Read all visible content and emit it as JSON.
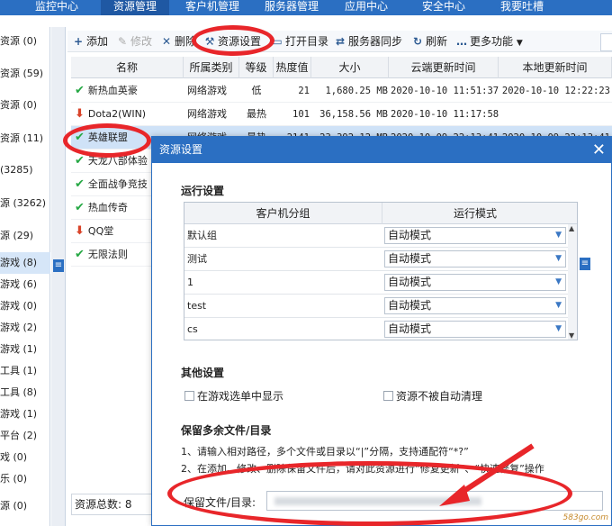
{
  "top_nav": {
    "tabs": [
      {
        "label": "监控中心"
      },
      {
        "label": "资源管理"
      },
      {
        "label": "客户机管理"
      },
      {
        "label": "服务器管理"
      },
      {
        "label": "应用中心"
      },
      {
        "label": "安全中心"
      },
      {
        "label": "我要吐槽"
      }
    ]
  },
  "sidebar": {
    "items": [
      {
        "label": "资源 (0)"
      },
      {
        "label": "资源 (59)"
      },
      {
        "label": "资源 (0)"
      },
      {
        "label": "资源 (11)"
      },
      {
        "label": "(3285)"
      },
      {
        "label": "源 (3262)"
      },
      {
        "label": "源 (29)"
      },
      {
        "label": "游戏 (8)"
      },
      {
        "label": "游戏 (6)"
      },
      {
        "label": "游戏 (0)"
      },
      {
        "label": "游戏 (2)"
      },
      {
        "label": "游戏 (1)"
      },
      {
        "label": "工具 (1)"
      },
      {
        "label": "工具 (8)"
      },
      {
        "label": "游戏 (1)"
      },
      {
        "label": "平台 (2)"
      },
      {
        "label": "戏 (0)"
      },
      {
        "label": "乐 (0)"
      },
      {
        "label": "源 (0)"
      }
    ]
  },
  "toolbar": {
    "add": "添加",
    "edit": "修改",
    "delete": "删除",
    "resource_settings": "资源设置",
    "open_dir": "打开目录",
    "server_sync": "服务器同步",
    "refresh": "刷新",
    "more": "更多功能"
  },
  "table": {
    "headers": [
      "名称",
      "所属类别",
      "等级",
      "热度值",
      "大小",
      "云端更新时间",
      "本地更新时间"
    ],
    "rows": [
      {
        "status": "check",
        "name": "新热血英豪",
        "category": "网络游戏",
        "level": "低",
        "heat": "21",
        "size": "1,680.25 MB",
        "cloud_time": "2020-10-10 11:51:37",
        "local_time": "2020-10-10 12:22:23"
      },
      {
        "status": "download",
        "name": "Dota2(WIN)",
        "category": "网络游戏",
        "level": "最热",
        "heat": "101",
        "size": "36,158.56 MB",
        "cloud_time": "2020-10-10 11:17:58",
        "local_time": ""
      },
      {
        "status": "check",
        "name": "英雄联盟",
        "category": "网络游戏",
        "level": "最热",
        "heat": "2141",
        "size": "23,392.12 MB",
        "cloud_time": "2020-10-09 22:13:41",
        "local_time": "2020-10-09 22:13:41"
      },
      {
        "status": "check",
        "name": "天龙八部体验",
        "category": "",
        "level": "",
        "heat": "",
        "size": "",
        "cloud_time": "",
        "local_time": ""
      },
      {
        "status": "check",
        "name": "全面战争竞技",
        "category": "",
        "level": "",
        "heat": "",
        "size": "",
        "cloud_time": "",
        "local_time": ""
      },
      {
        "status": "check",
        "name": "热血传奇",
        "category": "",
        "level": "",
        "heat": "",
        "size": "",
        "cloud_time": "",
        "local_time": ""
      },
      {
        "status": "download",
        "name": "QQ堂",
        "category": "",
        "level": "",
        "heat": "",
        "size": "",
        "cloud_time": "",
        "local_time": ""
      },
      {
        "status": "check",
        "name": "无限法则",
        "category": "",
        "level": "",
        "heat": "",
        "size": "",
        "cloud_time": "",
        "local_time": ""
      }
    ],
    "footer": "资源总数: 8"
  },
  "dialog": {
    "title": "资源设置",
    "run_section": "运行设置",
    "grid_headers": [
      "客户机分组",
      "运行模式"
    ],
    "grid_rows": [
      {
        "group": "默认组",
        "mode": "自动模式"
      },
      {
        "group": "测试",
        "mode": "自动模式"
      },
      {
        "group": "1",
        "mode": "自动模式"
      },
      {
        "group": "test",
        "mode": "自动模式"
      },
      {
        "group": "cs",
        "mode": "自动模式"
      }
    ],
    "other_section": "其他设置",
    "opt_show_in_menu": "在游戏选单中显示",
    "opt_no_auto_clean": "资源不被自动清理",
    "keep_section": "保留多余文件/目录",
    "note1": "1、请输入相对路径，多个文件或目录以“|”分隔，支持通配符“*?”",
    "note2": "2、在添加、修改、删除保留文件后，请对此资源进行“修复更新”、“快速修复”操作",
    "keep_label": "保留文件/目录:",
    "keep_value": ""
  },
  "watermark": "583go.com",
  "colors": {
    "accent": "#2b6fc2",
    "highlight": "#e8262a",
    "check": "#26a844",
    "download": "#d9442a"
  }
}
